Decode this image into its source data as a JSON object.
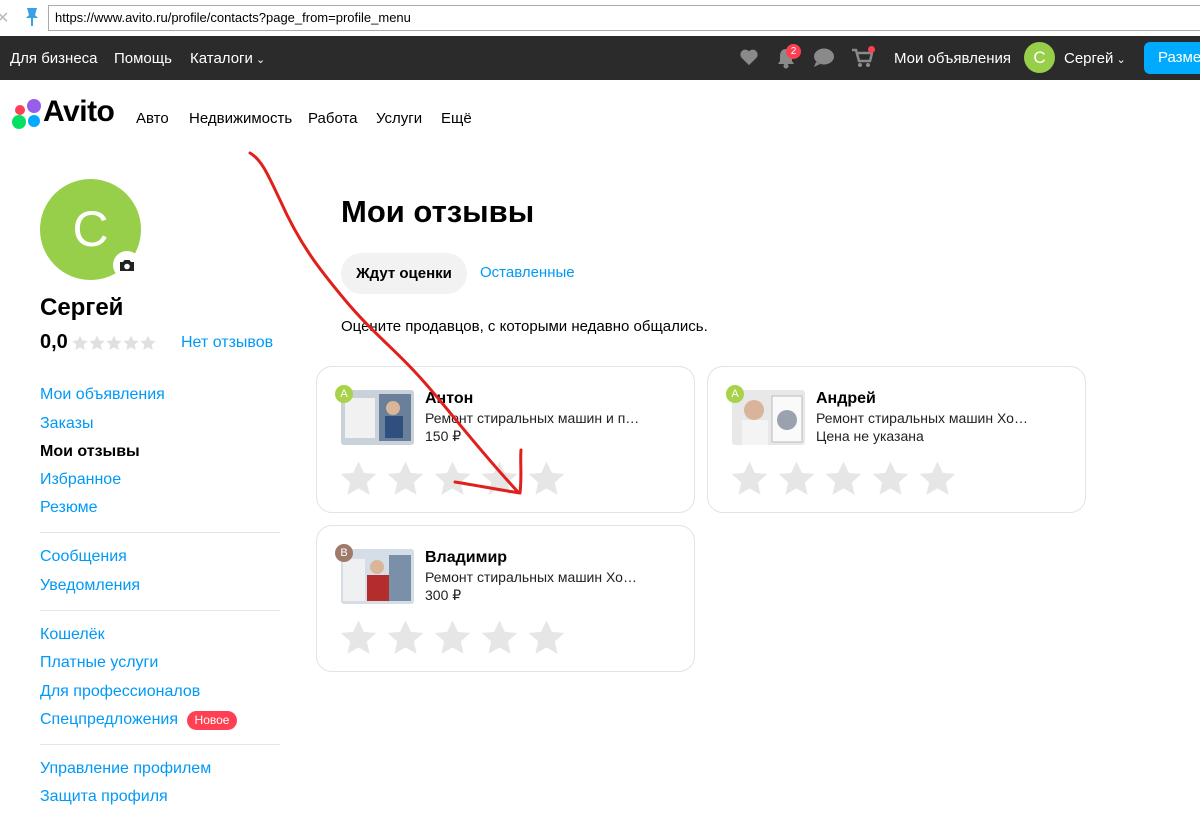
{
  "browser": {
    "url": "https://www.avito.ru/profile/contacts?page_from=profile_menu"
  },
  "topbar": {
    "for_business": "Для бизнеса",
    "help": "Помощь",
    "catalogs": "Каталоги",
    "notifications_count": "2",
    "my_ads": "Мои объявления",
    "user_initial": "С",
    "user_name": "Сергей",
    "post_button": "Разме"
  },
  "logo": {
    "text": "Avito"
  },
  "categories": [
    "Авто",
    "Недвижимость",
    "Работа",
    "Услуги",
    "Ещё"
  ],
  "sidebar": {
    "avatar_initial": "С",
    "name": "Сергей",
    "rating": "0,0",
    "no_reviews": "Нет отзывов",
    "groups": [
      [
        "Мои объявления",
        "Заказы",
        "Мои отзывы",
        "Избранное",
        "Резюме"
      ],
      [
        "Сообщения",
        "Уведомления"
      ],
      [
        "Кошелёк",
        "Платные услуги",
        "Для профессионалов",
        "Спецпредложения"
      ],
      [
        "Управление профилем",
        "Защита профиля"
      ]
    ],
    "new_badge": "Новое"
  },
  "main": {
    "title": "Мои отзывы",
    "tabs": [
      "Ждут оценки",
      "Оставленные"
    ],
    "hint": "Оцените продавцов, с которыми недавно общались.",
    "cards": [
      {
        "initial": "А",
        "avatar_color": "#a8d24a",
        "name": "Антон",
        "desc": "Ремонт стиральных машин и п…",
        "price": "150 ₽"
      },
      {
        "initial": "А",
        "avatar_color": "#a8d24a",
        "name": "Андрей",
        "desc": "Ремонт стиральных машин Хо…",
        "price": "Цена не указана"
      },
      {
        "initial": "В",
        "avatar_color": "#9e7a6a",
        "name": "Владимир",
        "desc": "Ремонт стиральных машин Хо…",
        "price": "300 ₽"
      }
    ]
  },
  "colors": {
    "link": "#0099f7",
    "topbar_bg": "#2b2b2b",
    "accent_green": "#97cf4a",
    "badge_red": "#ff4053",
    "annotation_red": "#e0201b"
  }
}
